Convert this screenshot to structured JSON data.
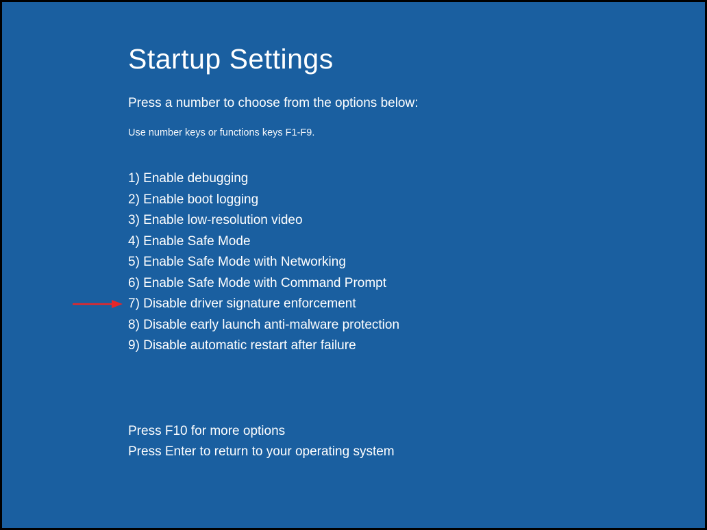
{
  "title": "Startup Settings",
  "instruction": "Press a number to choose from the options below:",
  "hint": "Use number keys or functions keys F1-F9.",
  "options": [
    {
      "num": "1",
      "label": "Enable debugging"
    },
    {
      "num": "2",
      "label": "Enable boot logging"
    },
    {
      "num": "3",
      "label": "Enable low-resolution video"
    },
    {
      "num": "4",
      "label": "Enable Safe Mode"
    },
    {
      "num": "5",
      "label": "Enable Safe Mode with Networking"
    },
    {
      "num": "6",
      "label": "Enable Safe Mode with Command Prompt"
    },
    {
      "num": "7",
      "label": "Disable driver signature enforcement"
    },
    {
      "num": "8",
      "label": "Disable early launch anti-malware protection"
    },
    {
      "num": "9",
      "label": "Disable automatic restart after failure"
    }
  ],
  "highlighted_index": 6,
  "footer": [
    "Press F10 for more options",
    "Press Enter to return to your operating system"
  ],
  "annotation": {
    "arrow_color": "#e6272a"
  }
}
